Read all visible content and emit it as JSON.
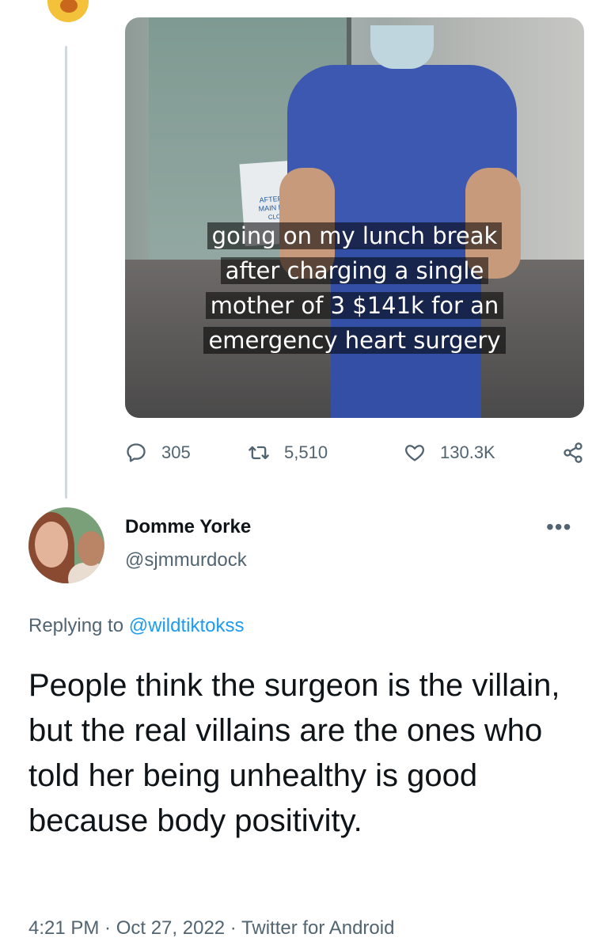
{
  "tweet_media": {
    "caption_lines": [
      "going on my lunch break",
      "after charging a single",
      "mother of 3 $141k for an",
      "emergency heart surgery"
    ],
    "sign_text": [
      "AFTER HOU",
      "MAIN ENTRA",
      "CLOSED"
    ]
  },
  "actions": {
    "reply_count": "305",
    "retweet_count": "5,510",
    "like_count": "130.3K"
  },
  "reply": {
    "display_name": "Domme Yorke",
    "handle": "@sjmmurdock",
    "more_label": "•••",
    "replying_prefix": "Replying to ",
    "replying_to": "@wildtiktokss",
    "text": "People think the surgeon is the villain, but the real villains are the ones who told her being unhealthy is good because body positivity.",
    "meta": "4:21 PM · Oct 27, 2022 · Twitter for Android"
  },
  "colors": {
    "text": "#0f1419",
    "secondary": "#536471",
    "link": "#1d9bf0",
    "thread_line": "#cfd9de"
  }
}
